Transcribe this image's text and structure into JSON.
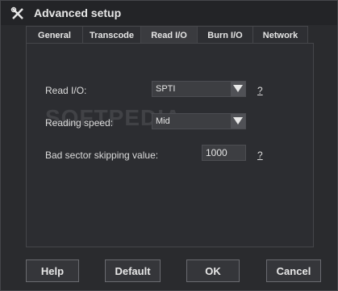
{
  "window": {
    "title": "Advanced setup"
  },
  "tabs": [
    {
      "label": "General"
    },
    {
      "label": "Transcode"
    },
    {
      "label": "Read I/O"
    },
    {
      "label": "Burn I/O"
    },
    {
      "label": "Network"
    }
  ],
  "active_tab": "Read I/O",
  "form": {
    "read_io_label": "Read I/O:",
    "read_io_value": "SPTI",
    "read_io_help": "?",
    "reading_speed_label": "Reading speed:",
    "reading_speed_value": "Mid",
    "bad_sector_label": "Bad sector skipping value:",
    "bad_sector_value": "1000",
    "bad_sector_help": "?"
  },
  "watermark": "SOFTPEDIA",
  "buttons": {
    "help": "Help",
    "default": "Default",
    "ok": "OK",
    "cancel": "Cancel"
  },
  "icons": {
    "title_icon": "tools-icon",
    "dropdown_icon": "triangle-down-icon"
  }
}
